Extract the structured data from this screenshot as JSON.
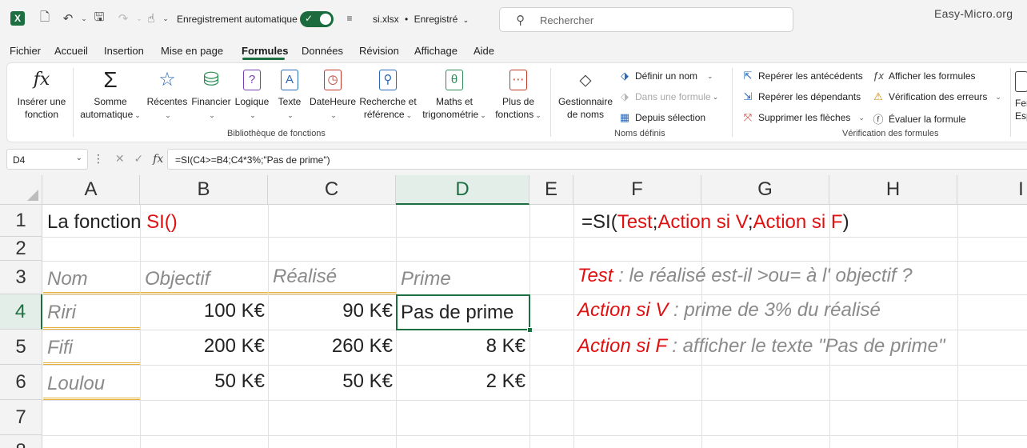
{
  "titlebar": {
    "app_icon": "excel-logo",
    "app_letter": "X",
    "autosave_label": "Enregistrement automatique",
    "autosave_on": true,
    "filename": "si.xlsx",
    "separator": "•",
    "save_status": "Enregistré",
    "search_placeholder": "Rechercher",
    "brand": "Easy-Micro.org"
  },
  "tabs": [
    {
      "label": "Fichier"
    },
    {
      "label": "Accueil"
    },
    {
      "label": "Insertion"
    },
    {
      "label": "Mise en page"
    },
    {
      "label": "Formules",
      "active": true
    },
    {
      "label": "Données"
    },
    {
      "label": "Révision"
    },
    {
      "label": "Affichage"
    },
    {
      "label": "Aide"
    }
  ],
  "ribbon": {
    "insert_function": {
      "line1": "Insérer une",
      "line2": "fonction"
    },
    "autosum": {
      "line1": "Somme",
      "line2": "automatique"
    },
    "library": [
      {
        "label": "Récentes"
      },
      {
        "label": "Financier"
      },
      {
        "label": "Logique"
      },
      {
        "label": "Texte"
      },
      {
        "label": "DateHeure"
      },
      {
        "label": "Recherche et",
        "label2": "référence"
      },
      {
        "label": "Maths et",
        "label2": "trigonométrie"
      },
      {
        "label": "Plus de",
        "label2": "fonctions"
      }
    ],
    "library_group": "Bibliothèque de fonctions",
    "name_manager": {
      "line1": "Gestionnaire",
      "line2": "de noms"
    },
    "defined_names": [
      {
        "label": "Définir un nom",
        "disabled": false
      },
      {
        "label": "Dans une formule",
        "disabled": true
      },
      {
        "label": "Depuis sélection",
        "disabled": false
      }
    ],
    "names_group": "Noms définis",
    "audit_left": [
      {
        "label": "Repérer les antécédents"
      },
      {
        "label": "Repérer les dépendants"
      },
      {
        "label": "Supprimer les flèches"
      }
    ],
    "audit_right": [
      {
        "label": "Afficher les formules"
      },
      {
        "label": "Vérification des erreurs"
      },
      {
        "label": "Évaluer la formule"
      }
    ],
    "audit_group": "Vérification des formules",
    "cut_off": {
      "line1": "Fer",
      "line2": "Esp"
    }
  },
  "formula_bar": {
    "name_box": "D4",
    "fx": "fx",
    "formula": "=SI(C4>=B4;C4*3%;\"Pas de prime\")"
  },
  "columns": [
    "A",
    "B",
    "C",
    "D",
    "E",
    "F",
    "G",
    "H",
    "I"
  ],
  "rows": [
    "1",
    "2",
    "3",
    "4",
    "5",
    "6",
    "7",
    "8"
  ],
  "selected_cell": "D4",
  "cells": {
    "a1_black": "La fonction ",
    "a1_red": "SI()",
    "f1": {
      "p1": "=SI(",
      "p2": "Test",
      "p3": ";",
      "p4": "Action si V",
      "p5": ";",
      "p6": "Action si F",
      "p7": ")"
    },
    "headers": {
      "nom": "Nom",
      "objectif": "Objectif",
      "realise": "Réalisé",
      "prime": "Prime"
    },
    "data": [
      {
        "nom": "Riri",
        "objectif": "100 K€",
        "realise": "90 K€",
        "prime": "Pas de prime"
      },
      {
        "nom": "Fifi",
        "objectif": "200 K€",
        "realise": "260 K€",
        "prime": "8 K€"
      },
      {
        "nom": "Loulou",
        "objectif": "50 K€",
        "realise": "50 K€",
        "prime": "2 K€"
      }
    ],
    "notes": [
      {
        "key": "Test",
        "text": " : le réalisé est-il >ou= à l' objectif ?"
      },
      {
        "key": "Action si V",
        "text": " : prime de 3% du réalisé"
      },
      {
        "key": "Action si F",
        "text": " : afficher le texte \"Pas de prime\""
      }
    ]
  }
}
